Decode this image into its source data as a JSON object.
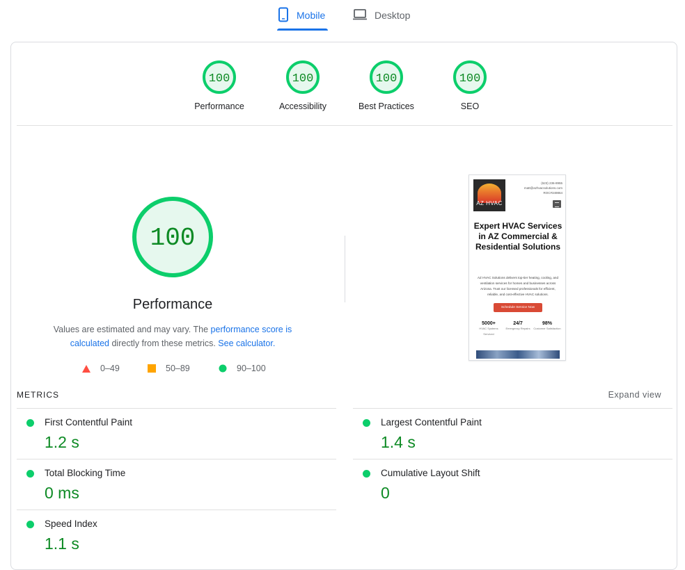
{
  "tabs": [
    {
      "label": "Mobile",
      "icon": "smartphone-icon",
      "active": true
    },
    {
      "label": "Desktop",
      "icon": "laptop-icon",
      "active": false
    }
  ],
  "colors": {
    "accent": "#1a73e8",
    "pass": "#0cce6b",
    "pass_dark": "#0d8a24",
    "pass_fill": "#e6f8ee",
    "average": "#ffa400",
    "fail": "#ff4e42"
  },
  "categories": [
    {
      "score": "100",
      "label": "Performance"
    },
    {
      "score": "100",
      "label": "Accessibility"
    },
    {
      "score": "100",
      "label": "Best Practices"
    },
    {
      "score": "100",
      "label": "SEO"
    }
  ],
  "performance": {
    "score": "100",
    "title": "Performance",
    "desc_pre": "Values are estimated and may vary. The ",
    "desc_link1": "performance score is calculated",
    "desc_mid": " directly from these metrics. ",
    "desc_link2": "See calculator."
  },
  "legend": [
    {
      "range": "0–49",
      "icon": "triangle-icon"
    },
    {
      "range": "50–89",
      "icon": "square-icon"
    },
    {
      "range": "90–100",
      "icon": "circle-icon"
    }
  ],
  "screenshot": {
    "logo_text": "AZ HVAC",
    "contact_lines": [
      "(623) 236-8955",
      "matt@azhvacsolutions.com",
      "ROC#349864"
    ],
    "title": "Expert HVAC Services in AZ Commercial & Residential Solutions",
    "text": "AZ HVAC Solutions delivers top-tier heating, cooling, and ventilation services for homes and businesses across Arizona. Trust our licensed professionals for efficient, reliable, and cost-effective HVAC solutions.",
    "cta": "Schedule Service Now",
    "stats": [
      {
        "value": "5000+",
        "label": "HVAC Systems Serviced"
      },
      {
        "value": "24/7",
        "label": "Emergency Repairs"
      },
      {
        "value": "98%",
        "label": "Customer Satisfaction"
      }
    ]
  },
  "metrics": {
    "heading": "METRICS",
    "expand": "Expand view",
    "items": [
      {
        "title": "First Contentful Paint",
        "value": "1.2 s"
      },
      {
        "title": "Largest Contentful Paint",
        "value": "1.4 s"
      },
      {
        "title": "Total Blocking Time",
        "value": "0 ms"
      },
      {
        "title": "Cumulative Layout Shift",
        "value": "0"
      },
      {
        "title": "Speed Index",
        "value": "1.1 s"
      }
    ]
  }
}
